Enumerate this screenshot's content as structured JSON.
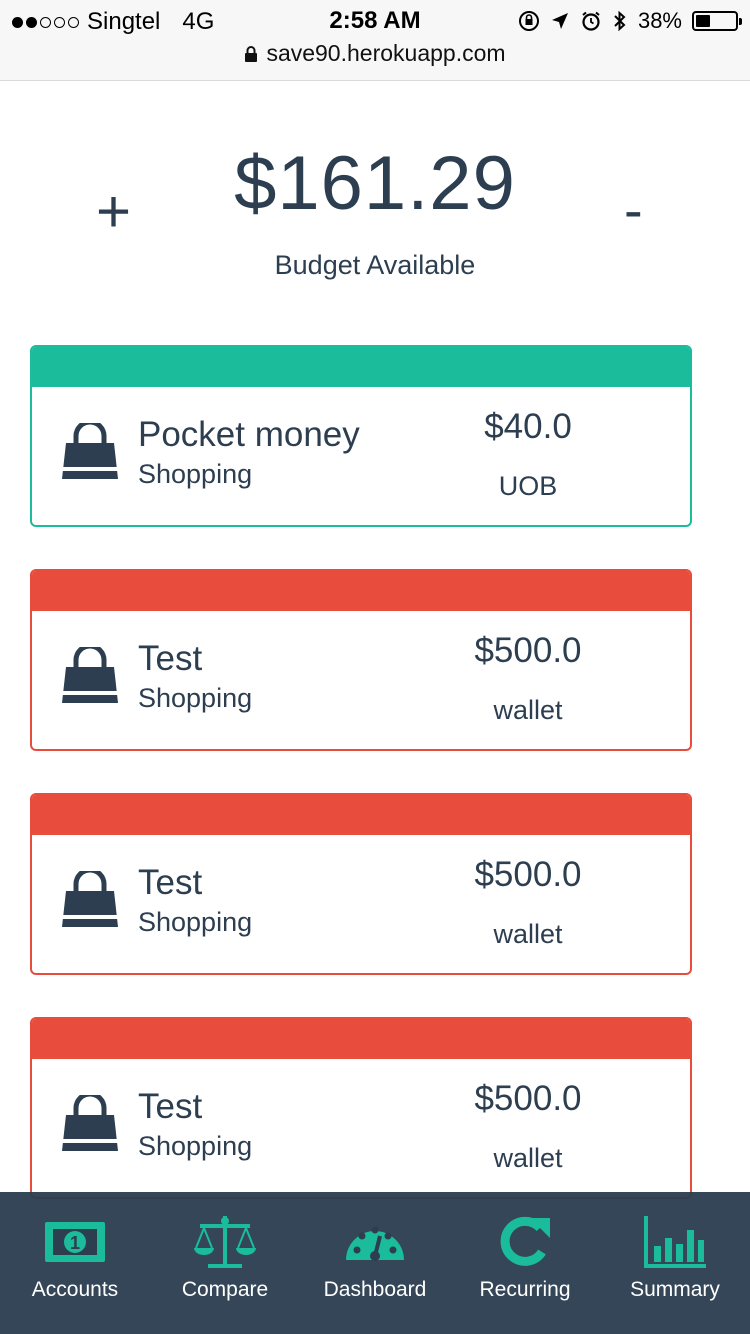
{
  "status_bar": {
    "carrier": "Singtel",
    "network": "4G",
    "time": "2:58 AM",
    "battery": "38%",
    "battery_level": 0.38,
    "url": "save90.herokuapp.com"
  },
  "budget": {
    "plus": "+",
    "minus": "-",
    "amount": "$161.29",
    "label": "Budget Available"
  },
  "colors": {
    "accent": "#1abc9c",
    "over": "#e74c3c",
    "text": "#2c3e50",
    "nav_bg": "#2c3e50"
  },
  "items": [
    {
      "title": "Pocket money",
      "category": "Shopping",
      "amount": "$40.0",
      "account": "UOB",
      "status": "green"
    },
    {
      "title": "Test",
      "category": "Shopping",
      "amount": "$500.0",
      "account": "wallet",
      "status": "red"
    },
    {
      "title": "Test",
      "category": "Shopping",
      "amount": "$500.0",
      "account": "wallet",
      "status": "red"
    },
    {
      "title": "Test",
      "category": "Shopping",
      "amount": "$500.0",
      "account": "wallet",
      "status": "red"
    }
  ],
  "nav": [
    {
      "label": "Accounts",
      "icon": "money-bill-icon"
    },
    {
      "label": "Compare",
      "icon": "scale-icon"
    },
    {
      "label": "Dashboard",
      "icon": "dashboard-gauge-icon"
    },
    {
      "label": "Recurring",
      "icon": "refresh-icon"
    },
    {
      "label": "Summary",
      "icon": "bar-chart-icon"
    }
  ]
}
